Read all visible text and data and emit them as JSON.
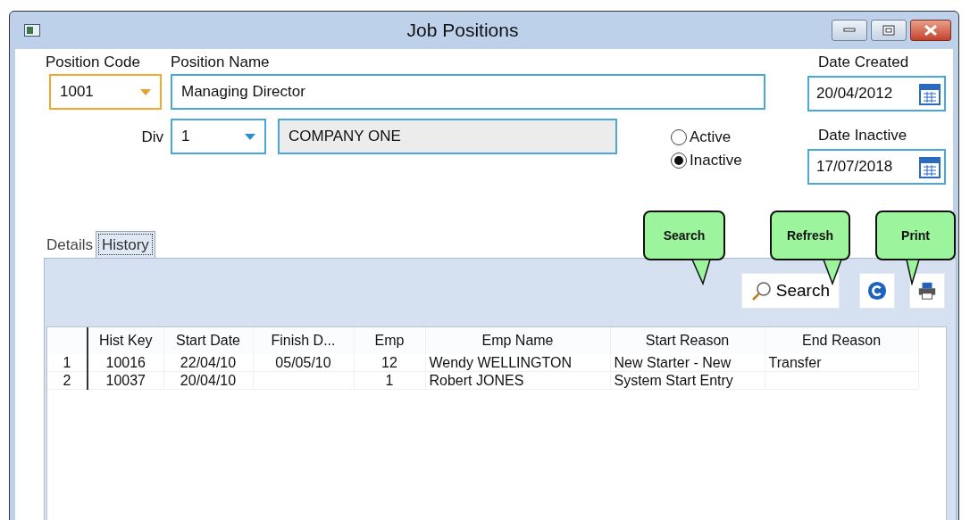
{
  "window": {
    "title": "Job Positions"
  },
  "position_code": {
    "label": "Position Code",
    "value": "1001"
  },
  "position_name": {
    "label": "Position Name",
    "value": "Managing Director"
  },
  "division": {
    "label": "Div",
    "value": "1",
    "name_value": "COMPANY ONE"
  },
  "date_created": {
    "label": "Date Created",
    "value": "20/04/2012"
  },
  "date_inactive": {
    "label": "Date Inactive",
    "value": "17/07/2018"
  },
  "status_options": [
    {
      "label": "Active",
      "selected": false
    },
    {
      "label": "Inactive",
      "selected": true
    }
  ],
  "tabs": [
    {
      "label": "Details",
      "selected": false
    },
    {
      "label": "History",
      "selected": true
    }
  ],
  "toolbar": {
    "search_label": "Search"
  },
  "callouts": [
    {
      "text": "Search"
    },
    {
      "text": "Refresh"
    },
    {
      "text": "Print"
    }
  ],
  "table": {
    "columns": [
      "Hist Key",
      "Start Date",
      "Finish D...",
      "Emp",
      "Emp Name",
      "Start Reason",
      "End Reason"
    ],
    "rows": [
      {
        "number": "1",
        "cells": [
          "10016",
          "22/04/10",
          "05/05/10",
          "12",
          "Wendy WELLINGTON",
          "New Starter - New",
          "Transfer"
        ]
      },
      {
        "number": "2",
        "cells": [
          "10037",
          "20/04/10",
          "",
          "1",
          "Robert JONES",
          "System Start Entry",
          ""
        ]
      }
    ]
  }
}
